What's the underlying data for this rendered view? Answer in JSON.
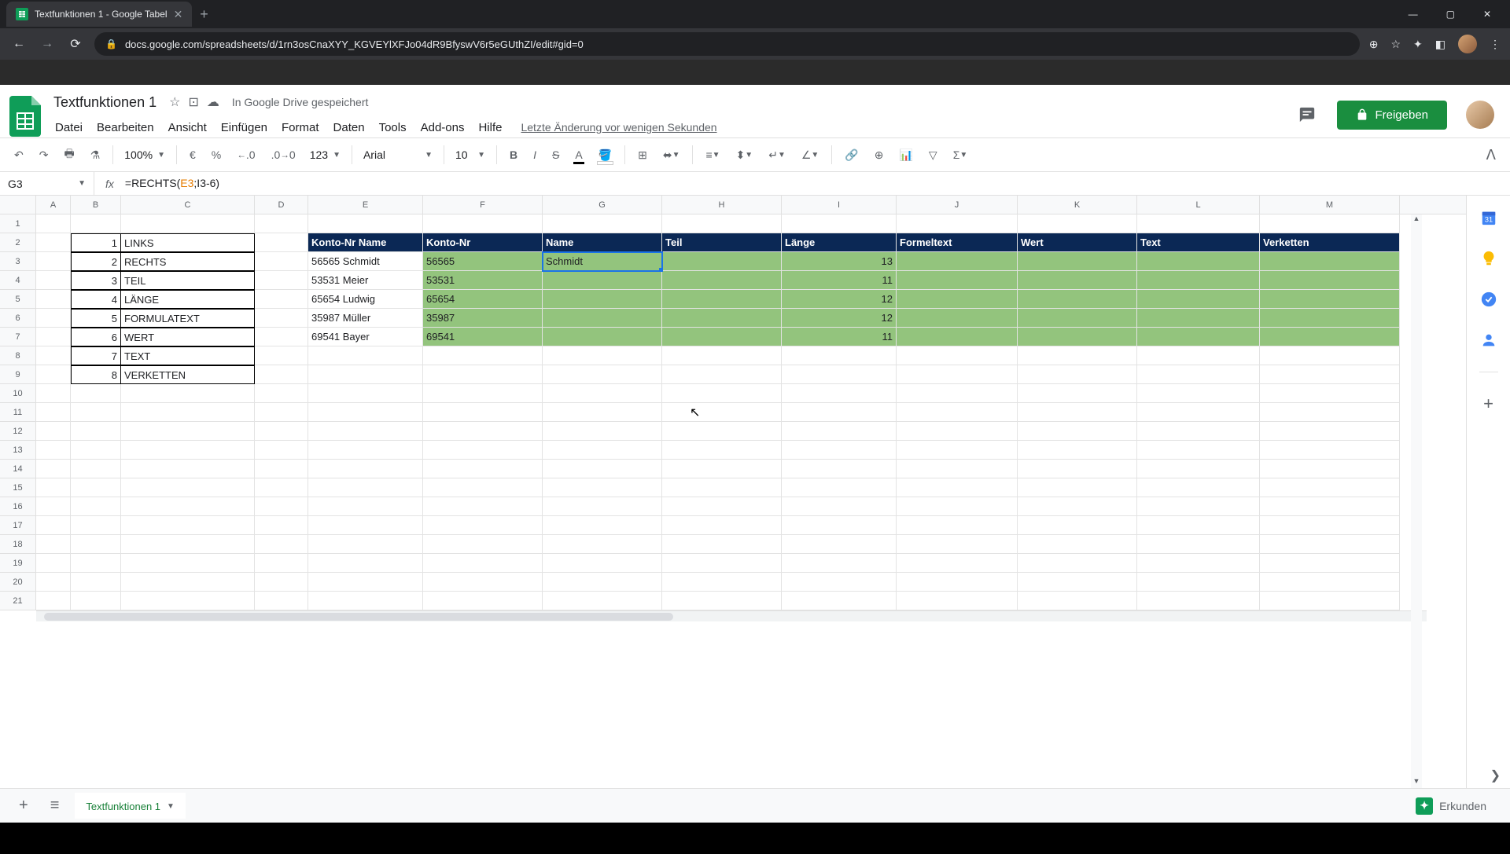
{
  "browser": {
    "tab_title": "Textfunktionen 1 - Google Tabel",
    "url": "docs.google.com/spreadsheets/d/1rn3osCnaXYY_KGVEYlXFJo04dR9BfyswV6r5eGUthZI/edit#gid=0"
  },
  "doc": {
    "title": "Textfunktionen 1",
    "save_status": "In Google Drive gespeichert",
    "last_edit": "Letzte Änderung vor wenigen Sekunden",
    "share": "Freigeben"
  },
  "menus": [
    "Datei",
    "Bearbeiten",
    "Ansicht",
    "Einfügen",
    "Format",
    "Daten",
    "Tools",
    "Add-ons",
    "Hilfe"
  ],
  "toolbar": {
    "zoom": "100%",
    "currency": "€",
    "percent": "%",
    "dec_less": ".0",
    "dec_more": ".00",
    "format_num": "123",
    "font": "Arial",
    "font_size": "10"
  },
  "formula": {
    "cell_ref": "G3",
    "prefix": "=RECHTS(",
    "ref": "E3",
    "suffix": ";I3-6)"
  },
  "columns": [
    "A",
    "B",
    "C",
    "D",
    "E",
    "F",
    "G",
    "H",
    "I",
    "J",
    "K",
    "L",
    "M"
  ],
  "func_list": {
    "nums": [
      "1",
      "2",
      "3",
      "4",
      "5",
      "6",
      "7",
      "8"
    ],
    "names": [
      "LINKS",
      "RECHTS",
      "TEIL",
      "LÄNGE",
      "FORMULATEXT",
      "WERT",
      "TEXT",
      "VERKETTEN"
    ]
  },
  "data_table": {
    "headers": [
      "Konto-Nr Name",
      "Konto-Nr",
      "Name",
      "Teil",
      "Länge",
      "Formeltext",
      "Wert",
      "Text",
      "Verketten"
    ],
    "rows": [
      {
        "e": "56565 Schmidt",
        "f": "56565",
        "g": "Schmidt",
        "i": "13"
      },
      {
        "e": "53531 Meier",
        "f": "53531",
        "g": "",
        "i": "11"
      },
      {
        "e": "65654 Ludwig",
        "f": "65654",
        "g": "",
        "i": "12"
      },
      {
        "e": "35987 Müller",
        "f": "35987",
        "g": "",
        "i": "12"
      },
      {
        "e": "69541 Bayer",
        "f": "69541",
        "g": "",
        "i": "11"
      }
    ]
  },
  "sheet": {
    "tab_name": "Textfunktionen 1",
    "explore": "Erkunden"
  }
}
